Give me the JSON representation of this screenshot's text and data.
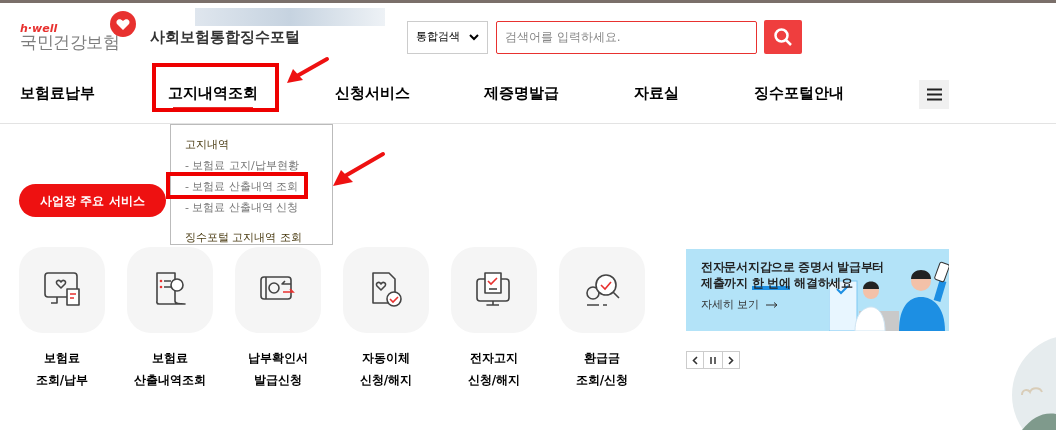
{
  "logo": {
    "tagline": "h·well",
    "name": "국민건강보험"
  },
  "site_title": "사회보험통합징수포털",
  "search": {
    "scope": "통합검색",
    "placeholder": "검색어를 입력하세요."
  },
  "nav": [
    {
      "label": "보험료납부",
      "selected": false,
      "highlighted": false
    },
    {
      "label": "고지내역조회",
      "selected": true,
      "highlighted": true
    },
    {
      "label": "신청서비스",
      "selected": false,
      "highlighted": false
    },
    {
      "label": "제증명발급",
      "selected": false,
      "highlighted": false
    },
    {
      "label": "자료실",
      "selected": false,
      "highlighted": false
    },
    {
      "label": "징수포털안내",
      "selected": false,
      "highlighted": false
    }
  ],
  "dropdown": [
    {
      "label": "고지내역",
      "kind": "heading",
      "highlighted": false
    },
    {
      "label": "- 보험료 고지/납부현황",
      "kind": "sub",
      "highlighted": false
    },
    {
      "label": "- 보험료 산출내역 조회",
      "kind": "sub",
      "highlighted": true
    },
    {
      "label": "- 보험료 산출내역 신청",
      "kind": "sub",
      "highlighted": false
    },
    {
      "label": "징수포털 고지내역 조회",
      "kind": "heading",
      "highlighted": false
    }
  ],
  "service_button": "사업장 주요 서비스",
  "services": [
    {
      "kind": "monitor",
      "lines": [
        "보험료",
        "조회/납부"
      ]
    },
    {
      "kind": "scroll",
      "lines": [
        "보험료",
        "산출내역조회"
      ]
    },
    {
      "kind": "wallet",
      "lines": [
        "납부확인서",
        "발급신청"
      ]
    },
    {
      "kind": "document",
      "lines": [
        "자동이체",
        "신청/해지"
      ]
    },
    {
      "kind": "screen",
      "lines": [
        "전자고지",
        "신청/해지"
      ]
    },
    {
      "kind": "magnifier",
      "lines": [
        "환급금",
        "조회/신청"
      ]
    }
  ],
  "banner": {
    "headline": [
      "전자문서지갑으로 증명서 발급부터",
      "제출까지 **한 번에** 해결하세요"
    ],
    "link": "자세히 보기"
  }
}
